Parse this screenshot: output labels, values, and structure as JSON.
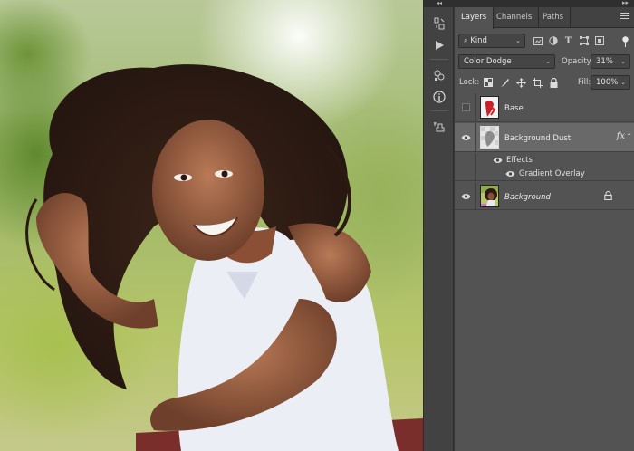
{
  "panel_strip": {
    "collapse_label": "◂◂",
    "icons": [
      "history-icon",
      "play-actions-icon",
      "properties-icon",
      "info-icon",
      "clone-source-icon"
    ]
  },
  "layers_panel": {
    "collapse_label": "▸▸",
    "tabs": [
      {
        "label": "Layers",
        "active": true
      },
      {
        "label": "Channels",
        "active": false
      },
      {
        "label": "Paths",
        "active": false
      }
    ],
    "filter": {
      "kind_label": "Kind",
      "kind_icons": [
        "image-filter-icon",
        "adjustment-filter-icon",
        "type-filter-icon",
        "shape-filter-icon",
        "smart-object-filter-icon"
      ]
    },
    "blend": {
      "mode": "Color Dodge",
      "opacity_label": "Opacity:",
      "opacity_value": "31%"
    },
    "lock": {
      "label": "Lock:",
      "icons": [
        "lock-transparent-icon",
        "lock-image-icon",
        "lock-position-icon",
        "lock-artboard-icon",
        "lock-all-icon"
      ],
      "fill_label": "Fill:",
      "fill_value": "100%"
    },
    "layers": [
      {
        "name": "Base",
        "visible": false,
        "selected": false
      },
      {
        "name": "Background Dust",
        "visible": true,
        "selected": true,
        "fx": "fx",
        "effects_label": "Effects",
        "effect_items": [
          "Gradient Overlay"
        ]
      },
      {
        "name": "Background",
        "visible": true,
        "selected": false,
        "locked": true
      }
    ]
  },
  "colors": {
    "panel_bg": "#535353",
    "selected_layer": "#696969",
    "tab_bar": "#424242"
  }
}
